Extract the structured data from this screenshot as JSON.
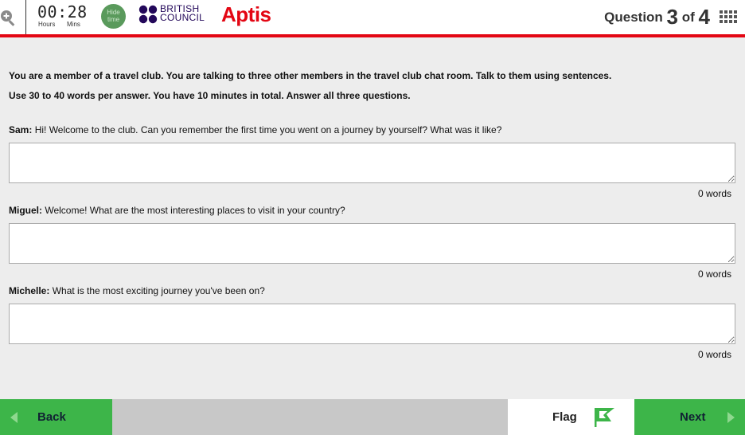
{
  "header": {
    "timer": "00:28",
    "timer_hours_label": "Hours",
    "timer_mins_label": "Mins",
    "hide_time_label": "Hide time",
    "brand_line1": "BRITISH",
    "brand_line2": "COUNCIL",
    "app_name": "Aptis",
    "question_label": "Question",
    "question_current": "3",
    "question_of": "of",
    "question_total": "4"
  },
  "instructions": [
    "You are a member of a travel club. You are talking to three other members in the travel club chat room. Talk to them using sentences.",
    "Use 30 to 40 words per answer. You have 10 minutes in total. Answer all three questions."
  ],
  "questions": [
    {
      "speaker": "Sam:",
      "text": "Hi! Welcome to the club. Can you remember the first time you went on a journey by yourself? What was it like?",
      "answer": "",
      "word_count": "0 words"
    },
    {
      "speaker": "Miguel:",
      "text": "Welcome! What are the most interesting places to visit in your country?",
      "answer": "",
      "word_count": "0 words"
    },
    {
      "speaker": "Michelle:",
      "text": "What is the most exciting journey you've been on?",
      "answer": "",
      "word_count": "0 words"
    }
  ],
  "footer": {
    "back_label": "Back",
    "flag_label": "Flag",
    "next_label": "Next"
  },
  "colors": {
    "accent_red": "#e30613",
    "button_green": "#3db549",
    "brand_navy": "#23085a"
  },
  "icons": {
    "zoom": "zoom-in-icon",
    "grid": "grid-menu-icon",
    "flag": "flag-icon",
    "back": "chevron-left-icon",
    "next": "chevron-right-icon"
  }
}
